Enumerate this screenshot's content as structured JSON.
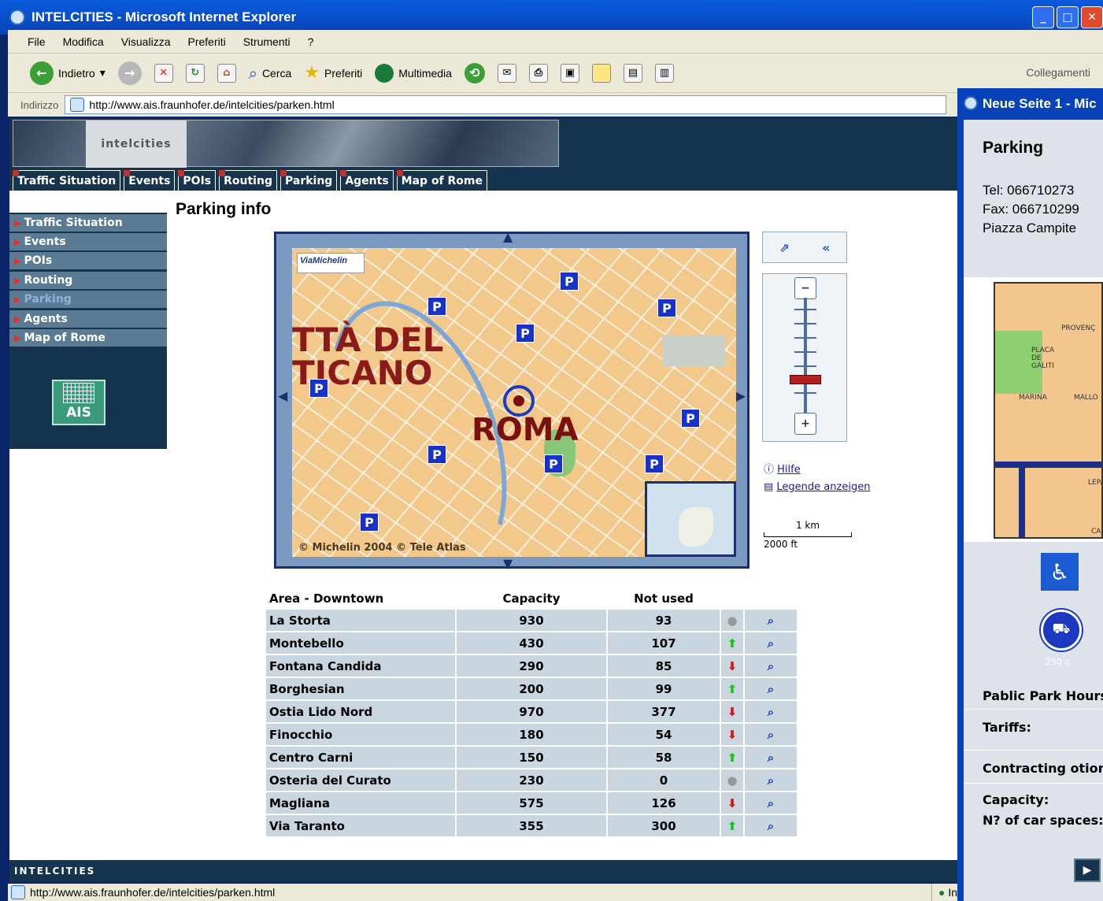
{
  "window": {
    "title": "INTELCITIES - Microsoft Internet Explorer",
    "controls": [
      "_",
      "□",
      "✕"
    ]
  },
  "menubar": [
    "File",
    "Modifica",
    "Visualizza",
    "Preferiti",
    "Strumenti",
    "?"
  ],
  "toolbar": {
    "back_label": "Indietro",
    "search_label": "Cerca",
    "favorites_label": "Preferiti",
    "multimedia_label": "Multimedia",
    "links_label": "Collegamenti"
  },
  "address": {
    "label": "Indirizzo",
    "url": "http://www.ais.fraunhofer.de/intelcities/parken.html"
  },
  "banner": {
    "logo_text": "intelcities"
  },
  "nav_tabs": [
    "Traffic Situation",
    "Events",
    "POIs",
    "Routing",
    "Parking",
    "Agents",
    "Map of Rome"
  ],
  "sidebar": {
    "items": [
      "Traffic Situation",
      "Events",
      "POIs",
      "Routing",
      "Parking",
      "Agents",
      "Map of Rome"
    ],
    "active": "Parking",
    "logo_text": "AIS"
  },
  "page": {
    "title": "Parking info"
  },
  "map": {
    "provider_logo": "ViaMichelin",
    "labels": {
      "city": "ROMA",
      "vatican_line1": "TTÀ DEL",
      "vatican_line2": "TICANO"
    },
    "copyright": "© Michelin 2004 © Tele Atlas",
    "help_link": "Hilfe",
    "legend_link": "Legende anzeigen",
    "scale_km": "1 km",
    "scale_ft": "2000 ft"
  },
  "parking_table": {
    "headers": {
      "area": "Area - Downtown",
      "capacity": "Capacity",
      "not_used": "Not used"
    },
    "rows": [
      {
        "name": "La Storta",
        "capacity": "930",
        "not_used": "93",
        "trend": "same"
      },
      {
        "name": "Montebello",
        "capacity": "430",
        "not_used": "107",
        "trend": "up"
      },
      {
        "name": "Fontana Candida",
        "capacity": "290",
        "not_used": "85",
        "trend": "down"
      },
      {
        "name": "Borghesian",
        "capacity": "200",
        "not_used": "99",
        "trend": "up"
      },
      {
        "name": "Ostia Lido Nord",
        "capacity": "970",
        "not_used": "377",
        "trend": "down"
      },
      {
        "name": "Finocchio",
        "capacity": "180",
        "not_used": "54",
        "trend": "down"
      },
      {
        "name": "Centro Carni",
        "capacity": "150",
        "not_used": "58",
        "trend": "up"
      },
      {
        "name": "Osteria del Curato",
        "capacity": "230",
        "not_used": "0",
        "trend": "same"
      },
      {
        "name": "Magliana",
        "capacity": "575",
        "not_used": "126",
        "trend": "down"
      },
      {
        "name": "Via Taranto",
        "capacity": "355",
        "not_used": "300",
        "trend": "up"
      }
    ]
  },
  "footer": {
    "text": "INTELCITIES"
  },
  "statusbar": {
    "url": "http://www.ais.fraunhofer.de/intelcities/parken.html",
    "zone": "Int"
  },
  "popup": {
    "title": "Neue Seite 1 - Mic",
    "heading": "Parking",
    "tel": "Tel: 066710273",
    "fax": "Fax: 066710299",
    "address": "Piazza Campite",
    "map_labels": [
      "PROVENÇ",
      "PLACA DE GALITI",
      "MALLO",
      "MARINA",
      "LEPANT",
      "CA"
    ],
    "truck_caption": "250 c",
    "rows": [
      "Pablic Park Hours",
      "Tariffs:",
      "Contracting otion",
      "Capacity:",
      "N? of car spaces:"
    ]
  },
  "colors": {
    "site_dark": "#16344d",
    "sidebar_item": "#5a7b93",
    "table_cell": "#c9d6e0",
    "parking_blue": "#1832c8",
    "trend_up": "#18c818",
    "trend_down": "#d81818"
  }
}
